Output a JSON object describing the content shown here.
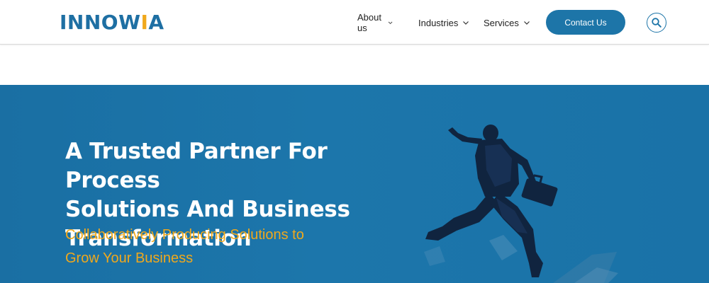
{
  "header": {
    "logo": {
      "prefix": "INNOW",
      "accent": "I",
      "suffix": "A"
    },
    "nav": [
      {
        "label": "About us"
      },
      {
        "label": "Industries"
      },
      {
        "label": "Services"
      }
    ],
    "contact_label": "Contact Us"
  },
  "hero": {
    "title_lines": [
      "A Trusted Partner For Process",
      "Solutions And Business",
      "Transformation"
    ],
    "subtitle_lines": [
      "Collaboratively Producing Solutions to",
      "Grow Your Business"
    ]
  },
  "colors": {
    "brand_blue": "#1d75a8",
    "accent_orange": "#f0a81c",
    "hero_bg": "#1a72a7"
  },
  "icons": {
    "search": "search-icon",
    "chevron": "chevron-down-icon"
  }
}
